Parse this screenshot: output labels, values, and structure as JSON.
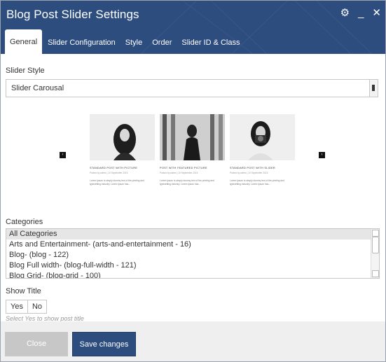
{
  "window": {
    "title": "Blog Post Slider Settings",
    "icons": {
      "settings": "⚙",
      "minimize": "_",
      "close": "✕"
    }
  },
  "tabs": [
    {
      "label": "General",
      "active": true
    },
    {
      "label": "Slider Configuration",
      "active": false
    },
    {
      "label": "Style",
      "active": false
    },
    {
      "label": "Order",
      "active": false
    },
    {
      "label": "Slider ID & Class",
      "active": false
    }
  ],
  "slider_style": {
    "label": "Slider Style",
    "selected": "Slider Carousal"
  },
  "preview": {
    "prev": "‹",
    "next": "›",
    "cards": [
      {
        "title": "Standard Post With Picture",
        "meta": "Posted by admin | 10 September 2015",
        "text": "Lorem ipsum is simply dummy text of the printing and typesetting industry. Lorem ipsum has..."
      },
      {
        "title": "Post With Featured Picture",
        "meta": "Posted by admin | 10 September 2015",
        "text": "Lorem ipsum is simply dummy text of the printing and typesetting industry. Lorem ipsum has..."
      },
      {
        "title": "Standard Post With Slider",
        "meta": "Posted by admin | 10 September 2015",
        "text": "Lorem ipsum is simply dummy text of the printing and typesetting industry. Lorem ipsum has..."
      }
    ]
  },
  "categories": {
    "label": "Categories",
    "items": [
      {
        "label": "All Categories",
        "selected": true
      },
      {
        "label": "Arts and Entertainment- (arts-and-entertainment - 16)",
        "selected": false
      },
      {
        "label": "Blog- (blog - 122)",
        "selected": false
      },
      {
        "label": "Blog Full width- (blog-full-width - 121)",
        "selected": false
      },
      {
        "label": "Blog Grid- (blog-grid - 100)",
        "selected": false
      }
    ]
  },
  "show_title": {
    "label": "Show Title",
    "yes": "Yes",
    "no": "No",
    "hint": "Select Yes to show post title"
  },
  "footer": {
    "close_label": "Close",
    "save_label": "Save changes"
  },
  "colors": {
    "header": "#2d4d7f",
    "save_button": "#2d4d7f",
    "close_button": "#c7c7c7"
  }
}
